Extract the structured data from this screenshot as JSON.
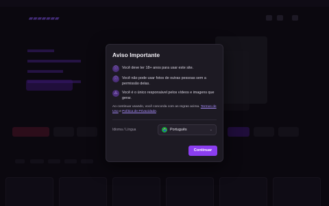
{
  "modal": {
    "title": "Aviso Importante",
    "rules": [
      {
        "icon": "info-circle-icon",
        "glyph": "ⓘ",
        "text": "Você deve ter 18+ anos para usar este site."
      },
      {
        "icon": "info-circle-icon",
        "glyph": "ⓘ",
        "text": "Você não pode usar fotos de outras pessoas sem a permissão delas."
      },
      {
        "icon": "warning-icon",
        "glyph": "⚠",
        "text": "Você é o único responsável pelos vídeos e imagens que gerar."
      }
    ],
    "notice_prefix": "Ao continuar usando, você concorda com as regras acima.",
    "terms_link": "Termos de Uso",
    "notice_conj": "e",
    "privacy_link": "Política de Privacidade",
    "notice_suffix": ".",
    "language_label": "Idioma / Língua",
    "language_value": "Português",
    "continue_label": "Continuar"
  },
  "colors": {
    "accent": "#8b3ef0",
    "link": "#a78bfa",
    "modal_bg": "#1d1a23"
  }
}
